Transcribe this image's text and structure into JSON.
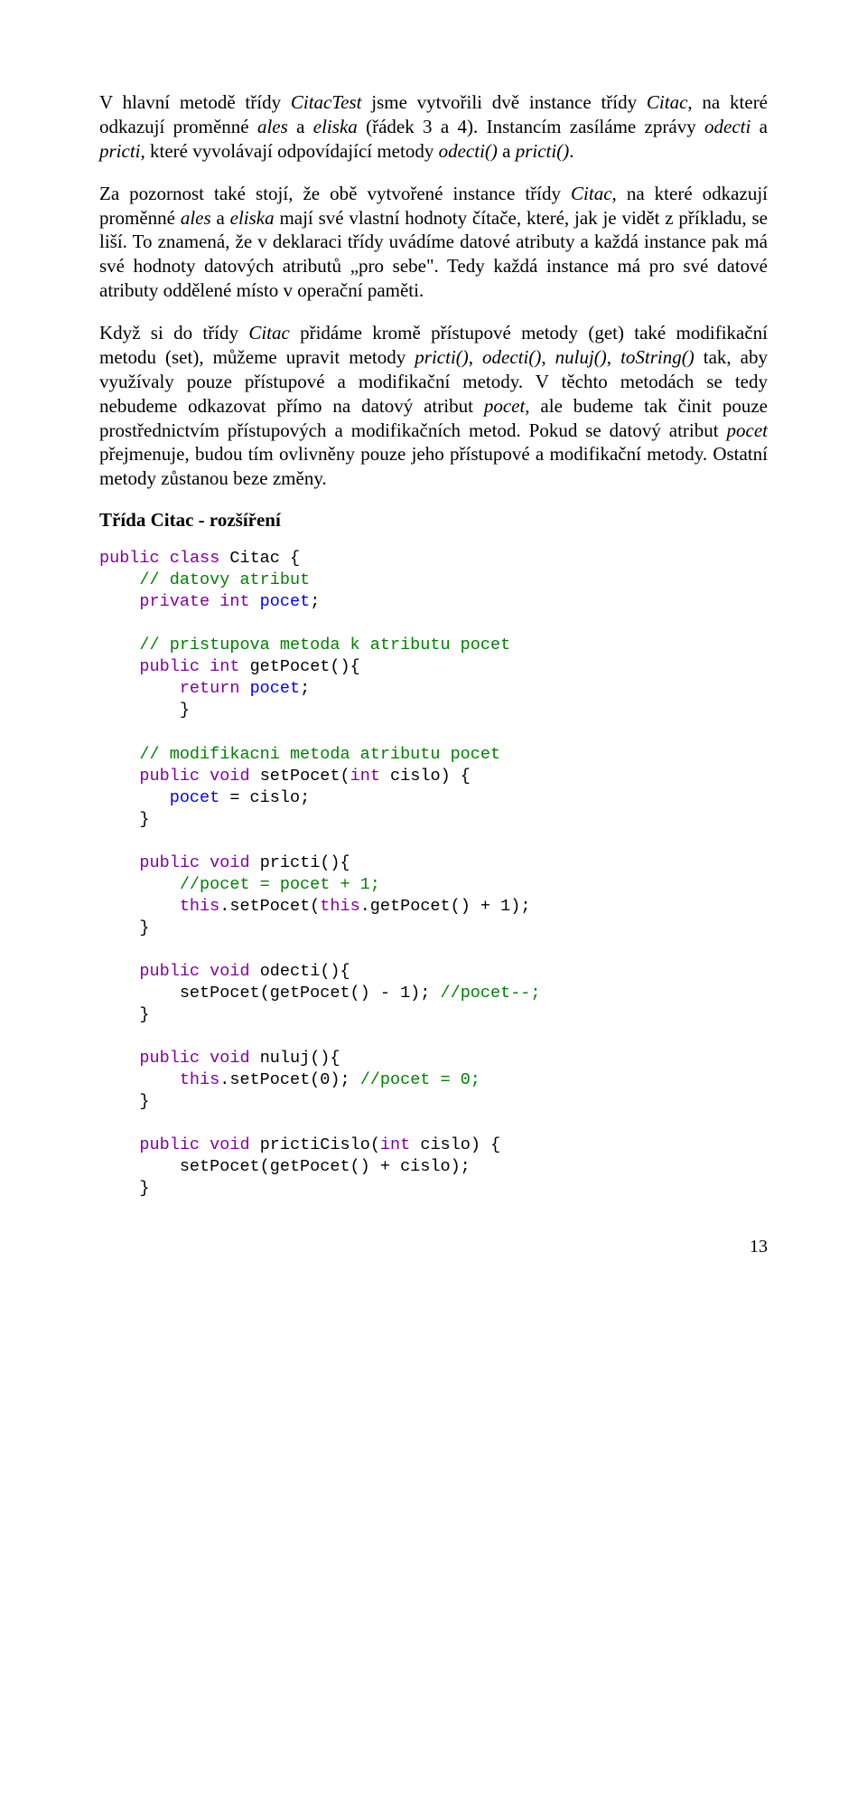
{
  "paragraphs": {
    "p1_a": "V hlavní metodě třídy ",
    "p1_b": "CitacTest",
    "p1_c": " jsme vytvořili dvě instance třídy ",
    "p1_d": "Citac",
    "p1_e": ", na které odkazují proměnné ",
    "p1_f": "ales",
    "p1_g": " a ",
    "p1_h": "eliska",
    "p1_i": " (řádek 3 a 4). Instancím zasíláme zprávy ",
    "p1_j": "odecti",
    "p1_k": " a ",
    "p1_l": "pricti",
    "p1_m": ", které vyvolávají odpovídající metody ",
    "p1_n": "odecti()",
    "p1_o": " a ",
    "p1_p": "pricti()",
    "p1_q": ".",
    "p2_a": "Za pozornost také stojí, že obě vytvořené instance třídy ",
    "p2_b": "Citac",
    "p2_c": ", na které odkazují proměnné ",
    "p2_d": "ales",
    "p2_e": " a ",
    "p2_f": "eliska",
    "p2_g": " mají své vlastní hodnoty čítače, které, jak je vidět z příkladu, se liší. To znamená, že v deklaraci třídy uvádíme datové atributy a každá instance pak má své hodnoty datových atributů „pro sebe\". Tedy každá instance má pro své datové atributy oddělené místo v operační paměti.",
    "p3_a": "Když si do třídy ",
    "p3_b": "Citac",
    "p3_c": " přidáme kromě přístupové metody (get) také modifikační metodu (set), můžeme upravit metody ",
    "p3_d": "pricti()",
    "p3_e": ", ",
    "p3_f": "odecti()",
    "p3_g": ", ",
    "p3_h": "nuluj()",
    "p3_i": ", ",
    "p3_j": "toString()",
    "p3_k": " tak, aby využívaly pouze přístupové a modifikační metody. V těchto metodách se tedy nebudeme odkazovat přímo na datový atribut ",
    "p3_l": "pocet",
    "p3_m": ", ale budeme tak činit pouze prostřednictvím přístupových a modifikačních metod. Pokud se datový atribut ",
    "p3_n": "pocet",
    "p3_o": " přejmenuje, budou tím ovlivněny pouze jeho přístupové a modifikační metody. Ostatní metody zůstanou beze změny."
  },
  "heading": "Třída Citac - rozšíření",
  "code": {
    "kw_public": "public",
    "kw_class": "class",
    "kw_private": "private",
    "kw_int": "int",
    "kw_void": "void",
    "kw_return": "return",
    "kw_this": "this",
    "id_Citac": "Citac",
    "id_pocet": "pocet",
    "id_getPocet": "getPocet",
    "id_setPocet": "setPocet",
    "id_cislo": "cislo",
    "id_pricti": "pricti",
    "id_odecti": "odecti",
    "id_nuluj": "nuluj",
    "id_prictiCislo": "prictiCislo",
    "c_datovy": "// datovy atribut",
    "c_pristup": "// pristupova metoda k atributu pocet",
    "c_modif": "// modifikacni metoda atributu pocet",
    "c_pricti": "//pocet = pocet + 1;",
    "c_odecti": "//pocet--;",
    "c_nuluj": "//pocet = 0;",
    "t_brace_o": " {",
    "t_brace_c": "}",
    "t_semi": ";",
    "t_lparen": "(",
    "t_rparen": ")",
    "t_funcbody_o": "(){",
    "t_body_o": ") {",
    "t_assign": " = ",
    "t_line_set_this": ".setPocet(",
    "t_line_get_this": ".getPocet() + 1);",
    "t_line_odecti_body": "setPocet(getPocet() - 1); ",
    "t_line_nuluj_body": ".setPocet(0); ",
    "t_line_prictiCislo_body": "setPocet(getPocet() + cislo);"
  },
  "pagenum": "13"
}
